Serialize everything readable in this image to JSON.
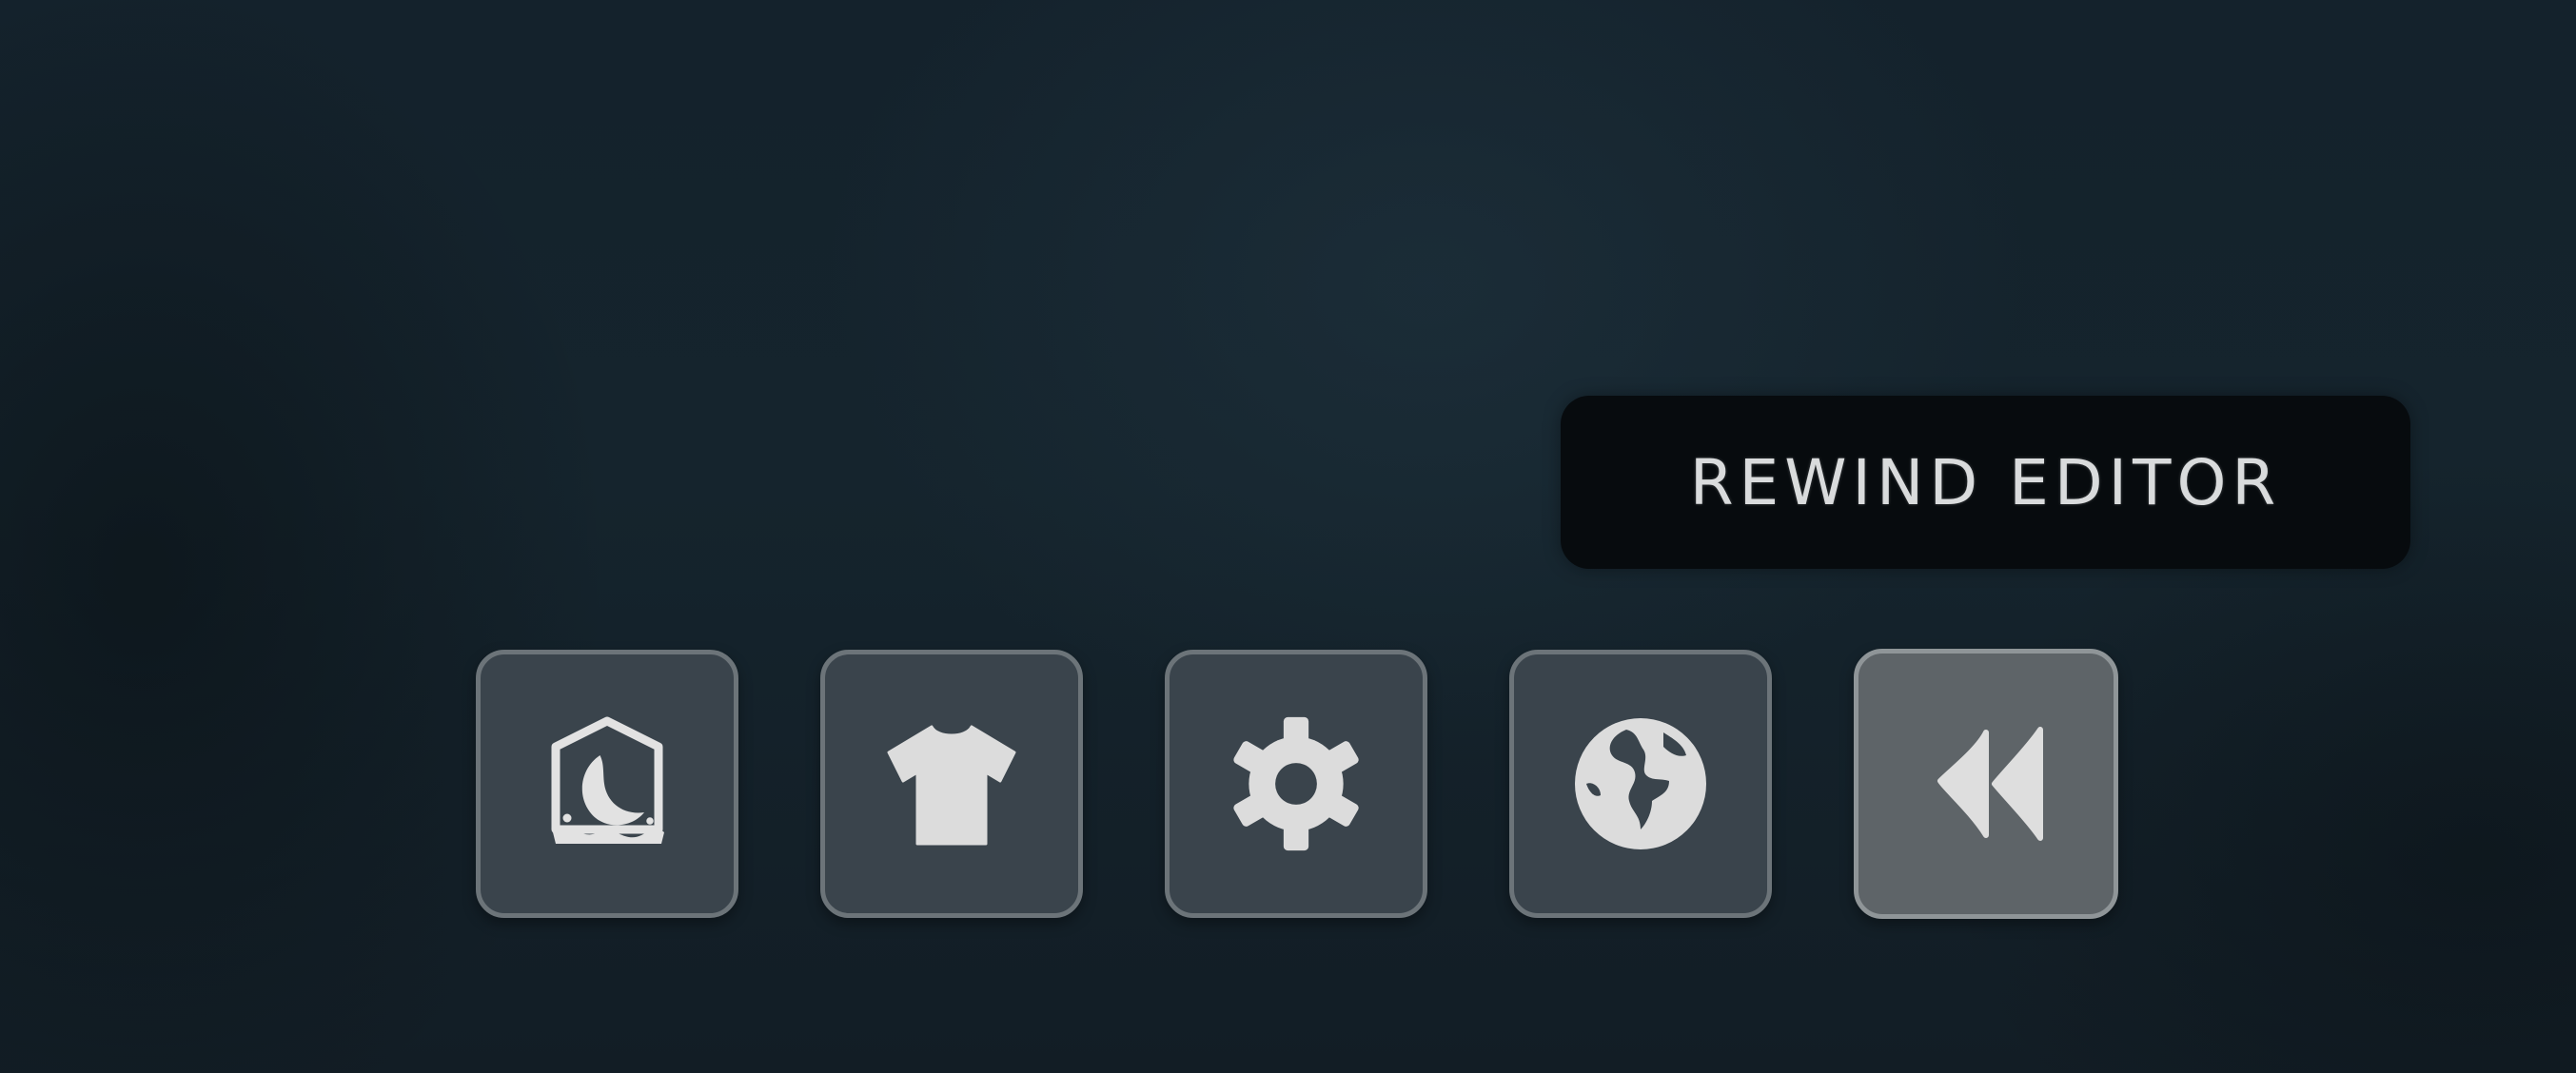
{
  "tooltip": {
    "text": "REWIND EDITOR"
  },
  "hotbar": {
    "items": [
      {
        "icon": "moon-hut-icon",
        "active": false
      },
      {
        "icon": "shirt-icon",
        "active": false
      },
      {
        "icon": "gear-icon",
        "active": false
      },
      {
        "icon": "globe-icon",
        "active": false
      },
      {
        "icon": "rewind-icon",
        "active": true
      }
    ]
  },
  "colors": {
    "background": "#13202a",
    "slot": "#3a444c",
    "slot_active": "#5e6468",
    "slot_border": "#6c7479",
    "icon": "#dcdcdc",
    "tooltip_bg": "#070b0e",
    "tooltip_text": "#d9dbdc"
  }
}
